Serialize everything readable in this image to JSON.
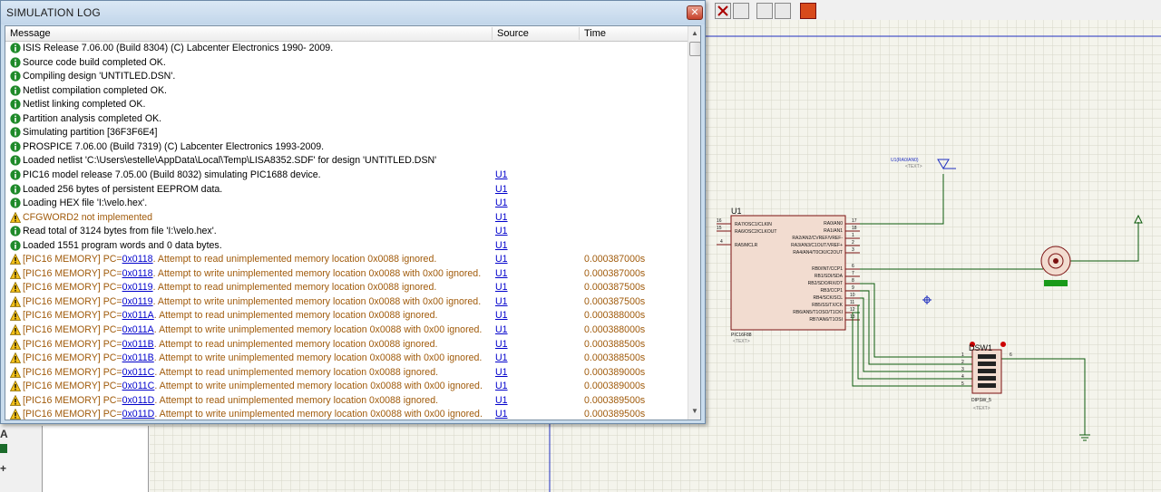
{
  "window": {
    "title": "SIMULATION LOG",
    "close_glyph": "✕"
  },
  "columns": {
    "message": "Message",
    "source": "Source",
    "time": "Time"
  },
  "rows": [
    {
      "icon": "info-icon",
      "text": "ISIS Release 7.06.00 (Build 8304) (C) Labcenter Electronics 1990- 2009.",
      "source": "",
      "time": ""
    },
    {
      "icon": "info-icon",
      "text": "Source code build completed OK.",
      "source": "",
      "time": ""
    },
    {
      "icon": "info-icon",
      "text": "Compiling design 'UNTITLED.DSN'.",
      "source": "",
      "time": ""
    },
    {
      "icon": "info-icon",
      "text": "Netlist compilation completed OK.",
      "source": "",
      "time": ""
    },
    {
      "icon": "info-icon",
      "text": "Netlist linking completed OK.",
      "source": "",
      "time": ""
    },
    {
      "icon": "info-icon",
      "text": "Partition analysis completed OK.",
      "source": "",
      "time": ""
    },
    {
      "icon": "info-icon",
      "text": "Simulating partition [36F3F6E4]",
      "source": "",
      "time": ""
    },
    {
      "icon": "info-icon",
      "text": "PROSPICE 7.06.00 (Build 7319) (C) Labcenter Electronics 1993-2009.",
      "source": "",
      "time": ""
    },
    {
      "icon": "info-icon",
      "text": "Loaded netlist 'C:\\Users\\estelle\\AppData\\Local\\Temp\\LISA8352.SDF' for design 'UNTITLED.DSN'",
      "source": "",
      "time": ""
    },
    {
      "icon": "info-icon",
      "text": "PIC16 model release 7.05.00 (Build 8032) simulating PIC1688 device.",
      "source": "U1",
      "time": ""
    },
    {
      "icon": "info-icon",
      "text": "Loaded 256 bytes of persistent EEPROM data.",
      "source": "U1",
      "time": ""
    },
    {
      "icon": "info-icon",
      "text": "Loading HEX file 'I:\\velo.hex'.",
      "source": "U1",
      "time": ""
    },
    {
      "icon": "warning-icon",
      "text": "CFGWORD2 not implemented",
      "source": "U1",
      "time": ""
    },
    {
      "icon": "info-icon",
      "text": "Read total of 3124 bytes from file 'I:\\velo.hex'.",
      "source": "U1",
      "time": ""
    },
    {
      "icon": "info-icon",
      "text": "Loaded 1551 program words and 0 data bytes.",
      "source": "U1",
      "time": ""
    },
    {
      "icon": "warning-icon",
      "prefix": "[PIC16 MEMORY] PC=",
      "pc": "0x0118",
      "text": ". Attempt to read unimplemented memory location 0x0088 ignored.",
      "source": "U1",
      "time": "0.000387000s"
    },
    {
      "icon": "warning-icon",
      "prefix": "[PIC16 MEMORY] PC=",
      "pc": "0x0118",
      "text": ". Attempt to write unimplemented memory location 0x0088 with 0x00 ignored.",
      "source": "U1",
      "time": "0.000387000s"
    },
    {
      "icon": "warning-icon",
      "prefix": "[PIC16 MEMORY] PC=",
      "pc": "0x0119",
      "text": ". Attempt to read unimplemented memory location 0x0088 ignored.",
      "source": "U1",
      "time": "0.000387500s"
    },
    {
      "icon": "warning-icon",
      "prefix": "[PIC16 MEMORY] PC=",
      "pc": "0x0119",
      "text": ". Attempt to write unimplemented memory location 0x0088 with 0x00 ignored.",
      "source": "U1",
      "time": "0.000387500s"
    },
    {
      "icon": "warning-icon",
      "prefix": "[PIC16 MEMORY] PC=",
      "pc": "0x011A",
      "text": ". Attempt to read unimplemented memory location 0x0088 ignored.",
      "source": "U1",
      "time": "0.000388000s"
    },
    {
      "icon": "warning-icon",
      "prefix": "[PIC16 MEMORY] PC=",
      "pc": "0x011A",
      "text": ". Attempt to write unimplemented memory location 0x0088 with 0x00 ignored.",
      "source": "U1",
      "time": "0.000388000s"
    },
    {
      "icon": "warning-icon",
      "prefix": "[PIC16 MEMORY] PC=",
      "pc": "0x011B",
      "text": ". Attempt to read unimplemented memory location 0x0088 ignored.",
      "source": "U1",
      "time": "0.000388500s"
    },
    {
      "icon": "warning-icon",
      "prefix": "[PIC16 MEMORY] PC=",
      "pc": "0x011B",
      "text": ". Attempt to write unimplemented memory location 0x0088 with 0x00 ignored.",
      "source": "U1",
      "time": "0.000388500s"
    },
    {
      "icon": "warning-icon",
      "prefix": "[PIC16 MEMORY] PC=",
      "pc": "0x011C",
      "text": ". Attempt to read unimplemented memory location 0x0088 ignored.",
      "source": "U1",
      "time": "0.000389000s"
    },
    {
      "icon": "warning-icon",
      "prefix": "[PIC16 MEMORY] PC=",
      "pc": "0x011C",
      "text": ". Attempt to write unimplemented memory location 0x0088 with 0x00 ignored.",
      "source": "U1",
      "time": "0.000389000s"
    },
    {
      "icon": "warning-icon",
      "prefix": "[PIC16 MEMORY] PC=",
      "pc": "0x011D",
      "text": ". Attempt to read unimplemented memory location 0x0088 ignored.",
      "source": "U1",
      "time": "0.000389500s"
    },
    {
      "icon": "warning-icon",
      "prefix": "[PIC16 MEMORY] PC=",
      "pc": "0x011D",
      "text": ". Attempt to write unimplemented memory location 0x0088 with 0x00 ignored.",
      "source": "U1",
      "time": "0.000389500s"
    }
  ],
  "schematic": {
    "mcu_ref": "U1",
    "mcu_part": "PIC16F88",
    "mcu_text": "<TEXT>",
    "mcu_left_pins": [
      {
        "num": "16",
        "label": "RA7/OSC1/CLKIN"
      },
      {
        "num": "15",
        "label": "RA6/OSC2/CLKOUT"
      },
      {
        "num": "4",
        "label": "RA5/MCLR"
      }
    ],
    "mcu_right_pins_top": [
      {
        "num": "17",
        "label": "RA0/AN0"
      },
      {
        "num": "18",
        "label": "RA1/AN1"
      },
      {
        "num": "1",
        "label": "RA2/AN2/CVREF/VREF-"
      },
      {
        "num": "2",
        "label": "RA3/AN3/C1OUT/VREF+"
      },
      {
        "num": "3",
        "label": "RA4/AN4/T0CKI/C2OUT"
      }
    ],
    "mcu_right_pins_bottom": [
      {
        "num": "6",
        "label": "RB0/INT/CCP1"
      },
      {
        "num": "7",
        "label": "RB1/SDI/SDA"
      },
      {
        "num": "8",
        "label": "RB2/SDO/RX/DT"
      },
      {
        "num": "9",
        "label": "RB3/CCP1"
      },
      {
        "num": "10",
        "label": "RB4/SCK/SCL"
      },
      {
        "num": "11",
        "label": "RB5/SS/TX/CK"
      },
      {
        "num": "12",
        "label": "RB6/AN5/T1OSO/T1CKI"
      },
      {
        "num": "13",
        "label": "RB7/AN6/T1OSI"
      }
    ],
    "probe_label": "U1(RA0/AN0)",
    "probe_text": "<TEXT>",
    "dsw_ref": "DSW1",
    "dsw_part": "DIPSW_5",
    "dsw_text": "<TEXT>",
    "dsw_pins": [
      "1",
      "2",
      "3",
      "4",
      "5"
    ],
    "dsw_out_pin": "6"
  },
  "colors": {
    "grid_bg": "#f4f4ec",
    "grid_line": "#d6d6c8",
    "wire": "#0b5a0b",
    "component_fill": "#f2dcd0",
    "component_stroke": "#7a1010",
    "pin_text": "#111111",
    "link": "#0000cc",
    "warning_text": "#a05a0a"
  }
}
